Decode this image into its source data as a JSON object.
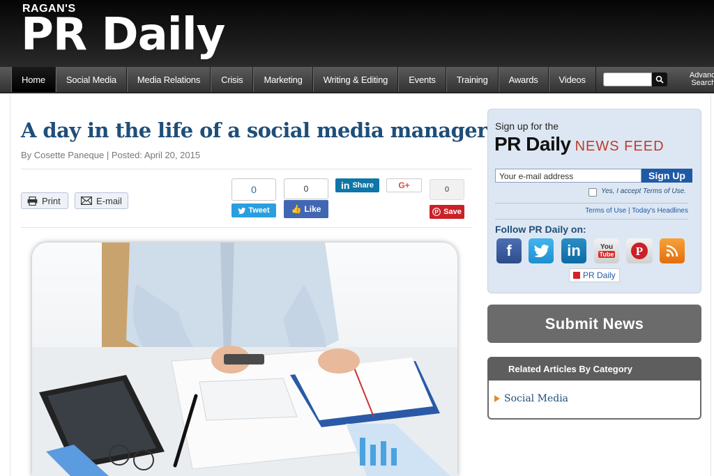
{
  "header": {
    "brand_small": "RAGAN'S",
    "brand_name": "PR Daily"
  },
  "nav": {
    "items": [
      "Home",
      "Social Media",
      "Media Relations",
      "Crisis",
      "Marketing",
      "Writing & Editing",
      "Events",
      "Training",
      "Awards",
      "Videos"
    ],
    "active": "Home",
    "advanced_search_line1": "Advanced",
    "advanced_search_line2": "Search »"
  },
  "article": {
    "title": "A day in the life of a social media manager",
    "byline": "By Cosette Paneque | Posted: April 20, 2015"
  },
  "tools": {
    "print_label": "Print",
    "email_label": "E-mail"
  },
  "social": {
    "tweet_count": "0",
    "tweet_label": "Tweet",
    "like_count": "0",
    "like_label": "Like",
    "linkedin_label": "Share",
    "gplus_label": "G+",
    "pin_count": "0",
    "pin_label": "Save"
  },
  "sidebar": {
    "signup_intro": "Sign up for the",
    "signup_brand": "PR Daily",
    "signup_feed": "NEWS FEED",
    "email_placeholder": "Your e-mail address",
    "signup_button": "Sign Up",
    "terms_accept": "Yes, I accept Terms of Use.",
    "terms_links": "Terms of Use | Today's Headlines",
    "follow_label": "Follow PR Daily on:",
    "youtube_top": "You",
    "youtube_bottom": "Tube",
    "flipboard_label": "PR Daily",
    "submit_news": "Submit News",
    "related_heading": "Related Articles By Category",
    "related_item": "Social Media"
  },
  "colors": {
    "title_blue": "#1f4e79",
    "news_feed_red": "#c0392b",
    "signup_blue": "#1f5aa6",
    "sidebar_bg": "#dde7f3"
  }
}
